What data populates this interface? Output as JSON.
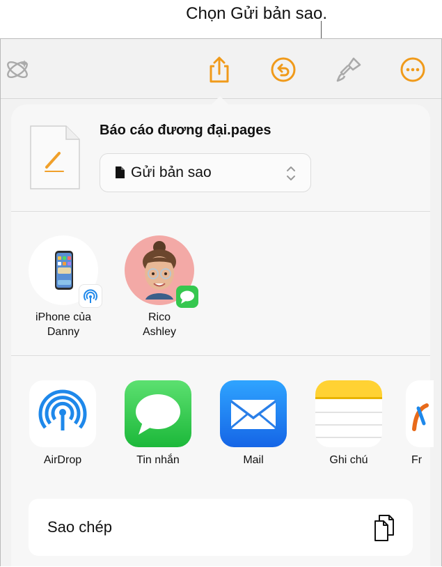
{
  "callout": {
    "text": "Chọn Gửi bản sao."
  },
  "toolbar": {
    "icons": [
      "sparkle-icon",
      "share-icon",
      "undo-icon",
      "paintbrush-icon",
      "more-icon"
    ],
    "accent": "#f09a1a"
  },
  "share_sheet": {
    "doc_title": "Báo cáo đương đại.pages",
    "send_option": "Gửi bản sao",
    "contacts": [
      {
        "name_line1": "iPhone của",
        "name_line2": "Danny"
      },
      {
        "name_line1": "Rico",
        "name_line2": "Ashley"
      }
    ],
    "apps": [
      {
        "label": "AirDrop"
      },
      {
        "label": "Tin nhắn"
      },
      {
        "label": "Mail"
      },
      {
        "label": "Ghi chú"
      },
      {
        "label": "Fr"
      }
    ],
    "copy_label": "Sao chép"
  }
}
